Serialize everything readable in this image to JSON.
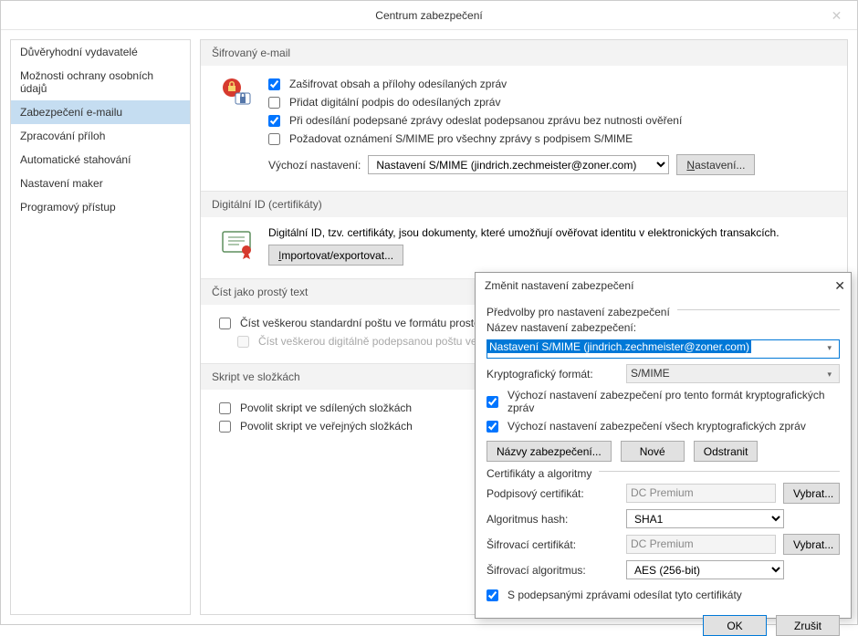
{
  "window": {
    "title": "Centrum zabezpečení"
  },
  "sidebar": {
    "items": [
      {
        "label": "Důvěryhodní vydavatelé"
      },
      {
        "label": "Možnosti ochrany osobních údajů"
      },
      {
        "label": "Zabezpečení e-mailu"
      },
      {
        "label": "Zpracování příloh"
      },
      {
        "label": "Automatické stahování"
      },
      {
        "label": "Nastavení maker"
      },
      {
        "label": "Programový přístup"
      }
    ]
  },
  "sections": {
    "enc": {
      "title": "Šifrovaný e-mail",
      "cb1": "Zašifrovat obsah a přílohy odesílaných zpráv",
      "cb2": "Přidat digitální podpis do odesílaných zpráv",
      "cb3": "Při odesílání podepsané zprávy odeslat podepsanou zprávu bez nutnosti ověření",
      "cb4": "Požadovat oznámení S/MIME pro všechny zprávy s podpisem S/MIME",
      "default_label": "Výchozí nastavení:",
      "default_value": "Nastavení S/MIME (jindrich.zechmeister@zoner.com)",
      "settings_btn": "Nastavení..."
    },
    "digid": {
      "title": "Digitální ID (certifikáty)",
      "text": "Digitální ID, tzv. certifikáty, jsou dokumenty, které umožňují ověřovat identitu v elektronických transakcích.",
      "import_btn": "Importovat/exportovat..."
    },
    "plain": {
      "title": "Číst jako prostý text",
      "cb1": "Číst veškerou standardní poštu ve formátu prostého textu",
      "cb2": "Číst veškerou digitálně podepsanou poštu ve formátu prostého textu"
    },
    "script": {
      "title": "Skript ve složkách",
      "cb1": "Povolit skript ve sdílených složkách",
      "cb2": "Povolit skript ve veřejných složkách"
    }
  },
  "popup": {
    "title": "Změnit nastavení zabezpečení",
    "group1": "Předvolby pro nastavení zabezpečení",
    "name_label": "Název nastavení zabezpečení:",
    "name_value": "Nastavení S/MIME (jindrich.zechmeister@zoner.com)",
    "crypto_label": "Kryptografický formát:",
    "crypto_value": "S/MIME",
    "cb1": "Výchozí nastavení zabezpečení pro tento formát kryptografických zpráv",
    "cb2": "Výchozí nastavení zabezpečení všech kryptografických zpráv",
    "btn_names": "Názvy zabezpečení...",
    "btn_new": "Nové",
    "btn_del": "Odstranit",
    "group2": "Certifikáty a algoritmy",
    "sign_cert_label": "Podpisový certifikát:",
    "sign_cert_value": "DC Premium",
    "choose_btn": "Vybrat...",
    "hash_label": "Algoritmus hash:",
    "hash_value": "SHA1",
    "enc_cert_label": "Šifrovací certifikát:",
    "enc_cert_value": "DC Premium",
    "enc_alg_label": "Šifrovací algoritmus:",
    "enc_alg_value": "AES (256-bit)",
    "cb_send": "S podepsanými zprávami odesílat tyto certifikáty",
    "ok": "OK",
    "cancel": "Zrušit"
  }
}
